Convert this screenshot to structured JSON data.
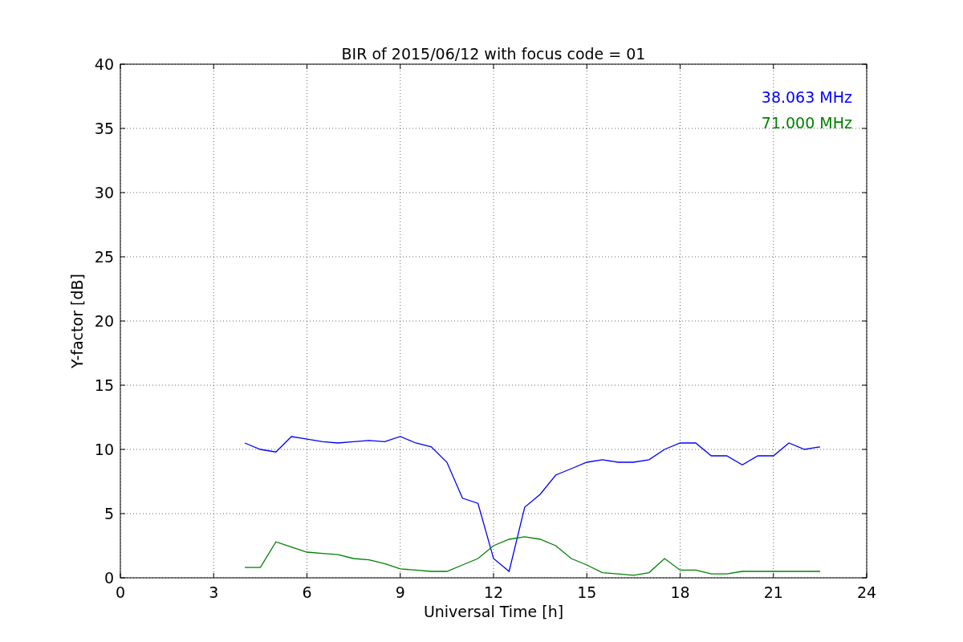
{
  "figure": {
    "chart_data": {
      "type": "line",
      "title": "BIR of 2015/06/12 with focus code = 01",
      "xlabel": "Universal Time [h]",
      "ylabel": "Y-factor [dB]",
      "x": [
        4,
        4.5,
        5,
        5.5,
        6,
        6.5,
        7,
        7.5,
        8,
        8.5,
        9,
        9.5,
        10,
        10.5,
        11,
        11.5,
        12,
        12.5,
        13,
        13.5,
        14,
        14.5,
        15,
        15.5,
        16,
        16.5,
        17,
        17.5,
        18,
        18.5,
        19,
        19.5,
        20,
        20.5,
        21,
        21.5,
        22,
        22.5
      ],
      "series": [
        {
          "name": "38.063 MHz",
          "color": "#0000ff",
          "values": [
            10.5,
            10,
            9.8,
            11,
            10.8,
            10.6,
            10.5,
            10.6,
            10.7,
            10.6,
            11,
            10.5,
            10.2,
            9,
            6.2,
            5.8,
            1.5,
            0.5,
            5.5,
            6.5,
            8,
            8.5,
            9,
            9.2,
            9,
            9,
            9.2,
            10,
            10.5,
            10.5,
            9.5,
            9.5,
            8.8,
            9.5,
            9.5,
            10.5,
            10,
            10.2
          ]
        },
        {
          "name": "71.000 MHz",
          "color": "#008000",
          "values": [
            0.8,
            0.8,
            2.8,
            2.4,
            2,
            1.9,
            1.8,
            1.5,
            1.4,
            1.1,
            0.7,
            0.6,
            0.5,
            0.5,
            1,
            1.5,
            2.5,
            3,
            3.2,
            3,
            2.5,
            1.5,
            1,
            0.4,
            0.3,
            0.2,
            0.4,
            1.5,
            0.6,
            0.6,
            0.3,
            0.3,
            0.5,
            0.5,
            0.5,
            0.5,
            0.5,
            0.5
          ]
        }
      ],
      "grid": true,
      "xlim": [
        0,
        24
      ],
      "ylim": [
        0,
        40
      ],
      "xticks": [
        0,
        3,
        6,
        9,
        12,
        15,
        18,
        21,
        24
      ],
      "yticks": [
        0,
        5,
        10,
        15,
        20,
        25,
        30,
        35,
        40
      ]
    }
  }
}
